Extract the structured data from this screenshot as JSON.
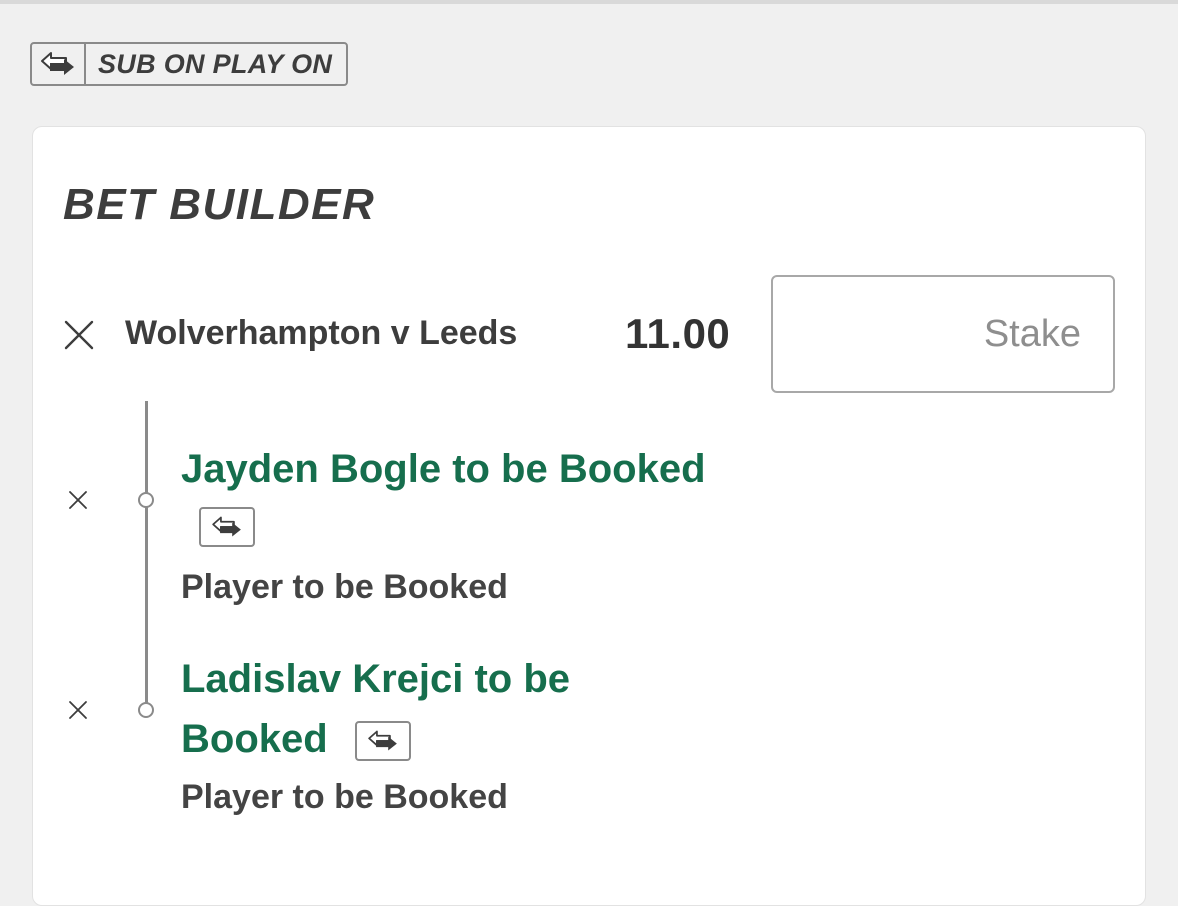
{
  "sub_on_play_on": {
    "label": "SUB ON PLAY ON",
    "icon": "substitution-arrows-icon"
  },
  "bet_builder": {
    "title": "BET BUILDER",
    "event": "Wolverhampton v Leeds",
    "odds": "11.00",
    "stake_placeholder": "Stake",
    "stake_value": "",
    "legs": [
      {
        "selection": "Jayden Bogle to be Booked",
        "market": "Player to be Booked",
        "sub_icon": "substitution-arrows-icon"
      },
      {
        "selection_line1": "Ladislav Krejci to be",
        "selection_line2": "Booked",
        "market": "Player to be Booked",
        "sub_icon": "substitution-arrows-icon"
      }
    ]
  },
  "colors": {
    "background": "#f0f0f0",
    "card": "#ffffff",
    "selection_green": "#166e4d",
    "text_dark": "#3d3d3d",
    "border_grey": "#8a8a8a"
  },
  "icons": {
    "remove": "close-icon"
  }
}
